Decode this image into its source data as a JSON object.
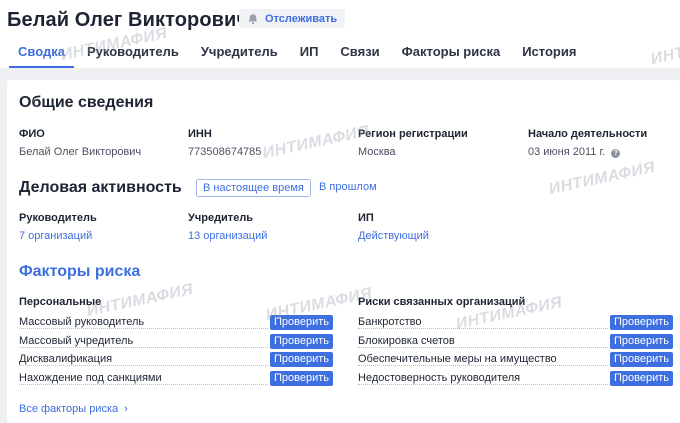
{
  "person": {
    "name": "Белай Олег Викторович"
  },
  "follow_button": {
    "label": "Отслеживать",
    "icon": "bell-icon"
  },
  "tabs": [
    {
      "label": "Сводка",
      "active": true
    },
    {
      "label": "Руководитель"
    },
    {
      "label": "Учредитель"
    },
    {
      "label": "ИП"
    },
    {
      "label": "Связи"
    },
    {
      "label": "Факторы риска"
    },
    {
      "label": "История"
    }
  ],
  "general": {
    "title": "Общие сведения",
    "fields": [
      {
        "label": "ФИО",
        "value": "Белай Олег Викторович"
      },
      {
        "label": "ИНН",
        "value": "773508674785"
      },
      {
        "label": "Регион регистрации",
        "value": "Москва"
      },
      {
        "label": "Начало деятельности",
        "value": "03 июня 2011 г."
      }
    ]
  },
  "business": {
    "title": "Деловая активность",
    "period_current": "В настоящее время",
    "period_past": "В прошлом",
    "items": [
      {
        "label": "Руководитель",
        "value": "7 организаций"
      },
      {
        "label": "Учредитель",
        "value": "13 организаций"
      },
      {
        "label": "ИП",
        "value": "Действующий"
      }
    ]
  },
  "risks": {
    "title": "Факторы риска",
    "personal": {
      "title": "Персональные",
      "items": [
        "Массовый руководитель",
        "Массовый учредитель",
        "Дисквалификация",
        "Нахождение под санкциями"
      ]
    },
    "related": {
      "title": "Риски связанных организаций",
      "items": [
        "Банкротство",
        "Блокировка счетов",
        "Обеспечительные меры на имущество",
        "Недостоверность руководителя"
      ]
    },
    "check_label": "Проверить",
    "all_link": "Все факторы риска"
  },
  "watermark": "ИНТИМАФИЯ",
  "colors": {
    "accent": "#3d6fe0",
    "text": "#1d2433",
    "background": "#eef0f4"
  }
}
